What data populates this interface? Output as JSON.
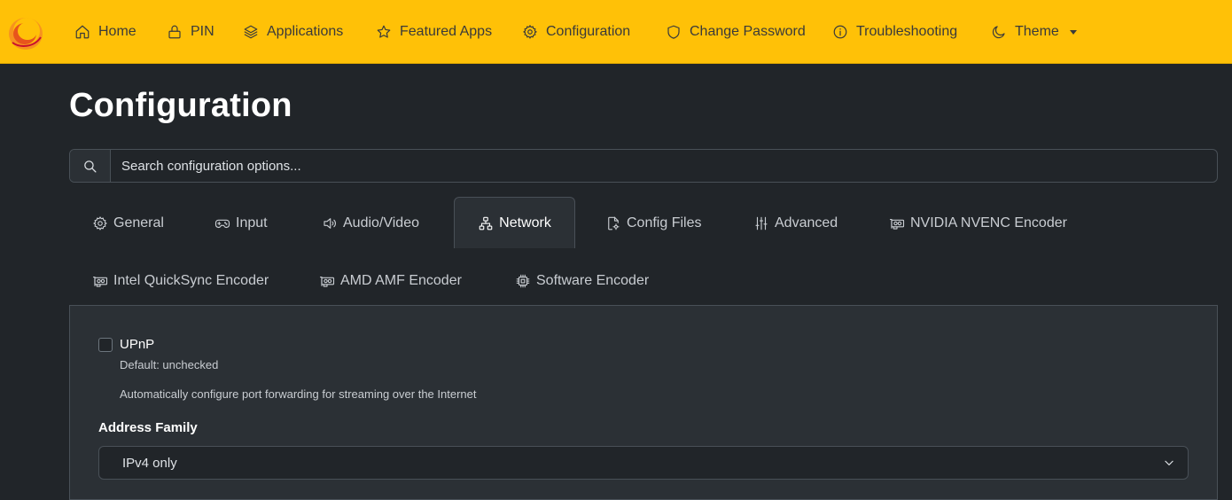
{
  "nav": {
    "items": [
      {
        "label": "Home",
        "icon": "home-icon"
      },
      {
        "label": "PIN",
        "icon": "lock-icon"
      },
      {
        "label": "Applications",
        "icon": "layers-icon"
      },
      {
        "label": "Featured Apps",
        "icon": "star-icon"
      },
      {
        "label": "Configuration",
        "icon": "gear-icon"
      },
      {
        "label": "Change Password",
        "icon": "shield-icon"
      },
      {
        "label": "Troubleshooting",
        "icon": "info-icon"
      },
      {
        "label": "Theme",
        "icon": "moon-icon"
      }
    ],
    "accent_color": "#ffc107"
  },
  "page": {
    "title": "Configuration"
  },
  "search": {
    "placeholder": "Search configuration options..."
  },
  "tabs": [
    {
      "label": "General",
      "icon": "gear-icon"
    },
    {
      "label": "Input",
      "icon": "gamepad-icon"
    },
    {
      "label": "Audio/Video",
      "icon": "speaker-icon"
    },
    {
      "label": "Network",
      "icon": "network-icon",
      "active": true
    },
    {
      "label": "Config Files",
      "icon": "file-gear-icon"
    },
    {
      "label": "Advanced",
      "icon": "sliders-icon"
    },
    {
      "label": "NVIDIA NVENC Encoder",
      "icon": "gpu-card-icon"
    },
    {
      "label": "Intel QuickSync Encoder",
      "icon": "gpu-card-icon"
    },
    {
      "label": "AMD AMF Encoder",
      "icon": "gpu-card-icon"
    },
    {
      "label": "Software Encoder",
      "icon": "cpu-icon"
    }
  ],
  "network": {
    "upnp": {
      "label": "UPnP",
      "checked": false,
      "default_text": "Default: unchecked",
      "help": "Automatically configure port forwarding for streaming over the Internet"
    },
    "address_family": {
      "label": "Address Family",
      "value": "IPv4 only"
    }
  }
}
